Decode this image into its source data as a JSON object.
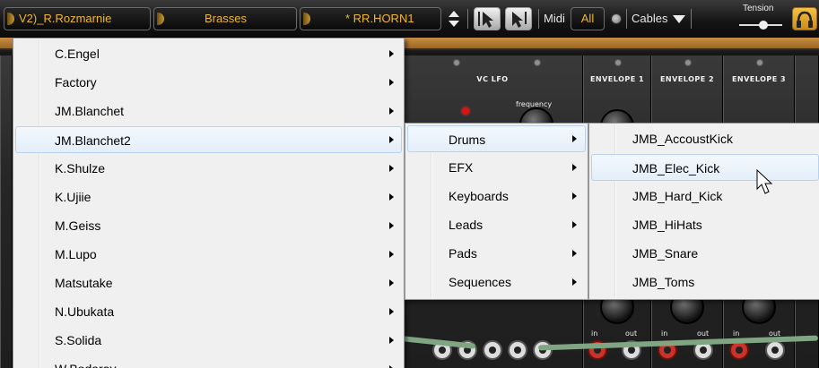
{
  "toolbar": {
    "patch_name": "V2)_R.Rozmarnie",
    "category": "Brasses",
    "preset": "* RR.HORN1",
    "midi_label": "Midi",
    "midi_value": "All",
    "cables_label": "Cables",
    "tension_label": "Tension"
  },
  "modules": {
    "lfo_title": "VC LFO",
    "lfo_param": "frequency",
    "env1_title": "ENVELOPE 1",
    "env2_title": "ENVELOPE 2",
    "env3_title": "ENVELOPE 3",
    "jack_in": "in",
    "jack_out": "out"
  },
  "menu1": {
    "items": [
      {
        "label": "C.Engel",
        "submenu": true
      },
      {
        "label": "Factory",
        "submenu": true
      },
      {
        "label": "JM.Blanchet",
        "submenu": true
      },
      {
        "label": "JM.Blanchet2",
        "submenu": true,
        "highlighted": true
      },
      {
        "label": "K.Shulze",
        "submenu": true
      },
      {
        "label": "K.Ujiie",
        "submenu": true
      },
      {
        "label": "M.Geiss",
        "submenu": true
      },
      {
        "label": "M.Lupo",
        "submenu": true
      },
      {
        "label": "Matsutake",
        "submenu": true
      },
      {
        "label": "N.Ubukata",
        "submenu": true
      },
      {
        "label": "S.Solida",
        "submenu": true
      },
      {
        "label": "W.Bodaray",
        "submenu": true
      }
    ]
  },
  "menu2": {
    "items": [
      {
        "label": "Drums",
        "submenu": true,
        "highlighted": true
      },
      {
        "label": "EFX",
        "submenu": true
      },
      {
        "label": "Keyboards",
        "submenu": true
      },
      {
        "label": "Leads",
        "submenu": true
      },
      {
        "label": "Pads",
        "submenu": true
      },
      {
        "label": "Sequences",
        "submenu": true
      }
    ]
  },
  "menu3": {
    "items": [
      {
        "label": "JMB_AccoustKick"
      },
      {
        "label": "JMB_Elec_Kick",
        "highlighted": true
      },
      {
        "label": "JMB_Hard_Kick"
      },
      {
        "label": "JMB_HiHats"
      },
      {
        "label": "JMB_Snare"
      },
      {
        "label": "JMB_Toms"
      }
    ]
  },
  "colors": {
    "toolbar_text": "#f0b82a",
    "menu_bg": "#f0f0f0",
    "menu_highlight": "#e4eef9",
    "wood_strip": "#b57a34"
  }
}
